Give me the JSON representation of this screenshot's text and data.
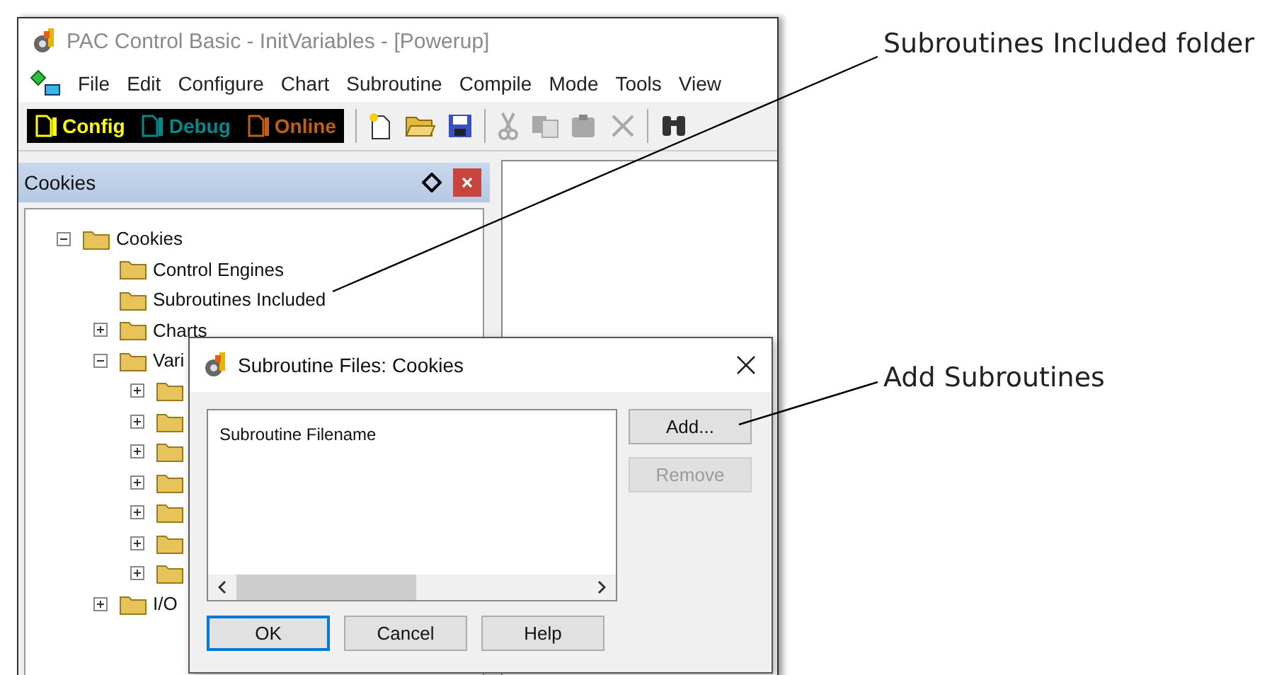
{
  "window": {
    "title": "PAC Control Basic - InitVariables - [Powerup]"
  },
  "menu": [
    "File",
    "Edit",
    "Configure",
    "Chart",
    "Subroutine",
    "Compile",
    "Mode",
    "Tools",
    "View"
  ],
  "modes": [
    {
      "label": "Config",
      "color": "#ffff00"
    },
    {
      "label": "Debug",
      "color": "#008b8b"
    },
    {
      "label": "Online",
      "color": "#c06010"
    }
  ],
  "toolbar": [
    {
      "kind": "new",
      "disabled": false
    },
    {
      "kind": "open",
      "disabled": false
    },
    {
      "kind": "save",
      "disabled": false
    },
    {
      "kind": "separator"
    },
    {
      "kind": "cut",
      "disabled": true
    },
    {
      "kind": "copy",
      "disabled": true
    },
    {
      "kind": "paste",
      "disabled": true
    },
    {
      "kind": "delete",
      "disabled": true
    },
    {
      "kind": "separator"
    },
    {
      "kind": "find",
      "disabled": false
    }
  ],
  "strategy_panel": {
    "title": "Cookies",
    "tree": [
      {
        "label": "Cookies",
        "expanded": true,
        "children": [
          {
            "label": "Control Engines"
          },
          {
            "label": "Subroutines Included"
          },
          {
            "label": "Charts",
            "expanded": false
          },
          {
            "label": "Vari",
            "expanded": true,
            "children": [
              {
                "expanded": false
              },
              {
                "expanded": false
              },
              {
                "expanded": false
              },
              {
                "expanded": false
              },
              {
                "expanded": false
              },
              {
                "expanded": false
              },
              {
                "expanded": false
              }
            ]
          },
          {
            "label": "I/O",
            "expanded": false
          }
        ]
      }
    ]
  },
  "dialog": {
    "title": "Subroutine Files: Cookies",
    "list_header": "Subroutine Filename",
    "side_buttons": [
      {
        "label": "Add...",
        "disabled": false
      },
      {
        "label": "Remove",
        "disabled": true
      }
    ],
    "buttons": [
      {
        "label": "OK",
        "focused": true
      },
      {
        "label": "Cancel",
        "focused": false
      },
      {
        "label": "Help",
        "focused": false
      }
    ]
  },
  "callouts": [
    {
      "text": "Subroutines Included folder"
    },
    {
      "text": "Add Subroutines"
    }
  ]
}
